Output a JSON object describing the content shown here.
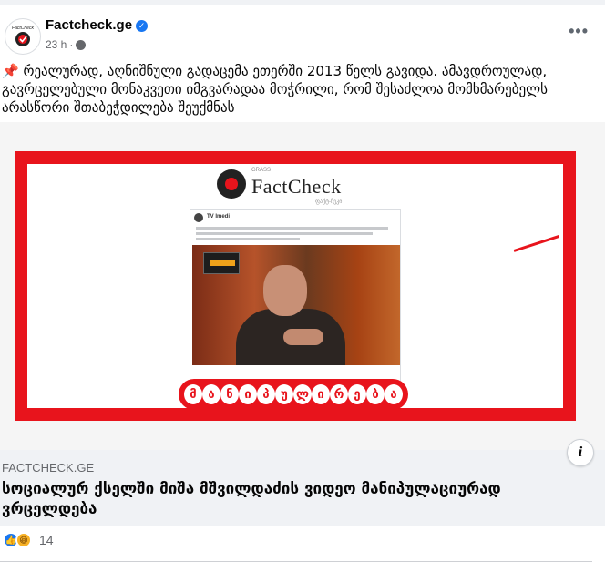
{
  "post": {
    "page_name": "Factcheck.ge",
    "time": "23 h",
    "avatar_text": "FactCheck",
    "caption": "📌 რეალურად, აღნიშნული გადაცემა ეთერში 2013 წელს გავიდა. ამავდროულად, გავრცელებული მონაკვეთი იმგვარადაა მოჭრილი, რომ შესაძლოა მომხმარებელს არასწორი შთაბეჭდილება შეუქმნას"
  },
  "media": {
    "logo_text": "FactCheck",
    "logo_small": "GRASS",
    "logo_sub": "ფაქტ-ჩეკი",
    "inner_page": "TV Imedi",
    "label_letters": [
      "მ",
      "ა",
      "ნ",
      "ი",
      "პ",
      "უ",
      "ლ",
      "ი",
      "რ",
      "ე",
      "ბ",
      "ა"
    ]
  },
  "link": {
    "domain": "FACTCHECK.GE",
    "title": "სოციალურ ქსელში მიშა მშვილდაძის ვიდეო მანიპულაციურად ვრცელდება"
  },
  "reactions": {
    "count": "14"
  },
  "colors": {
    "accent_red": "#e8141c",
    "facebook_blue": "#1877f2"
  }
}
